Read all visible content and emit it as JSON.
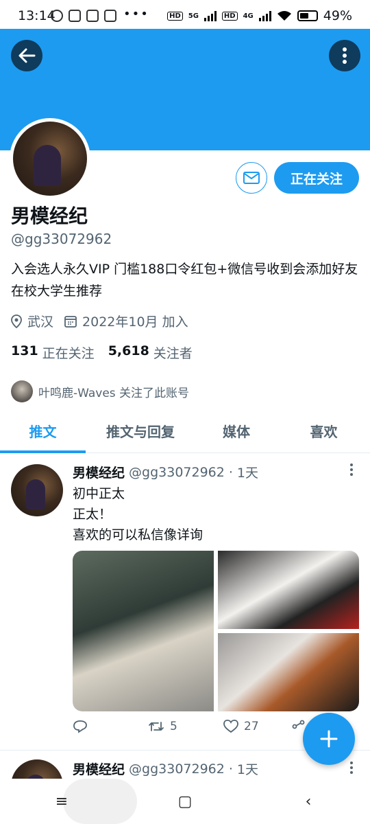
{
  "status_bar": {
    "time": "13:14",
    "dots": "•••",
    "network_5g": "5G",
    "network_4g": "4G",
    "hd": "HD",
    "battery": "49%"
  },
  "banner": {
    "color": "#1d9bf0"
  },
  "profile": {
    "name": "男模经纪",
    "handle": "@gg33072962",
    "bio": "入会选人永久VIP 门槛188口令红包+微信号收到会添加好友 在校大学生推荐",
    "location": "武汉",
    "joined": "2022年10月 加入",
    "following_count": "131",
    "following_label": "正在关注",
    "followers_count": "5,618",
    "followers_label": "关注者",
    "follow_button": "正在关注",
    "followed_by": "叶鸣鹿-Waves 关注了此账号"
  },
  "tabs": [
    {
      "label": "推文",
      "active": true
    },
    {
      "label": "推文与回复",
      "active": false
    },
    {
      "label": "媒体",
      "active": false
    },
    {
      "label": "喜欢",
      "active": false
    }
  ],
  "tweets": [
    {
      "name": "男模经纪",
      "handle": "@gg33072962",
      "separator": "·",
      "time": "1天",
      "lines": [
        "初中正太",
        "正太！",
        "喜欢的可以私信像详询"
      ],
      "retweets": "5",
      "likes": "27"
    },
    {
      "name": "男模经纪",
      "handle": "@gg33072962",
      "separator": "·",
      "time": "1天"
    }
  ],
  "system_nav": {
    "menu": "≡",
    "home": "▢",
    "back": "‹"
  }
}
